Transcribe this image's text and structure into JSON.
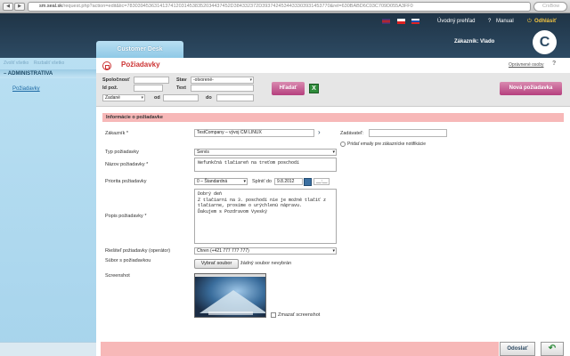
{
  "browser": {
    "back": "◀",
    "forward": "▶",
    "url_host": "sm.seal.sk",
    "url_rest": "/request.php?action=edit&lic=78303945363141374120314538352034437452D384332372D3937424534433303931453770&rel=630BABD6C03C709D055A3FF0",
    "search_placeholder": "CrsBow"
  },
  "header": {
    "flags": [
      "uk-flag",
      "cz-flag",
      "sk-flag"
    ],
    "nav": {
      "home": "Úvodný prehľad",
      "manual": "Manual",
      "logout": "Odhlásiť"
    },
    "tab": "Customer Desk",
    "customer": "Zákazník: Vlado",
    "logo": "C"
  },
  "sidebar": {
    "expand": "Zvoliť všetko",
    "collapse": "Rozbaliť všetko",
    "section": "ADMINISTRATIVA",
    "item": "Požiadavky"
  },
  "page": {
    "title": "Požiadavky",
    "oprav": "Oprávnené osoby",
    "help": "?"
  },
  "filter": {
    "spolocnost_label": "Spoločnosť",
    "spolocnost_value": "",
    "stav_label": "Stav",
    "stav_value": "-otvorené-",
    "id_label": "Id pož.",
    "id_value": "",
    "text_label": "Text",
    "text_value": "",
    "zadane_value": "Zadané",
    "od_label": "od",
    "od_value": "",
    "do_label": "do",
    "do_value": "",
    "search_button": "Hľadať",
    "excel_icon": "X",
    "new_button": "Nová požiadavka"
  },
  "form": {
    "section_title": "Informácie o požiadavke",
    "zakaznik_label": "Zákazník *",
    "zakaznik_value": "TestCompany – vývoj CM LINUX",
    "zadavatel_label": "Zadávateľ:",
    "zadavatel_value": "",
    "emails_label": "Pridať emaily pre zákaznícke notifikácie",
    "typ_label": "Typ požiadavky",
    "typ_value": "Servis",
    "nazov_label": "Názov požiadavky *",
    "nazov_value": "Nefunkčná tlačiareň na treťom poschodí",
    "priorita_label": "Priorita požiadavky",
    "priorita_value": "0 – Štandardná",
    "splnit_label": "Splniť do",
    "splnit_value": "9.8.2012",
    "time_value": "__:__",
    "popis_label": "Popis požiadavky *",
    "popis_value": "Dobrý deň\nZ tlačiarni na 3. poschodí nie je možné tlačiť z tlačiarne, prosíme o urýchlenú nápravu.\nĎakujem s Pozdravom Vyeský",
    "riesitel_label": "Riešiteľ požiadavky (operátor)",
    "riesitel_value": "Chren (+421 777 777 777)",
    "subor_label": "Súbor s požiadavkou",
    "file_button": "Vybrať soubor",
    "file_value": "žádný soubor nevybrán",
    "screenshot_label": "Screenshot",
    "remove_screenshot": "Zmazať screenshot"
  },
  "footer": {
    "send": "Odoslať",
    "back_icon": "↶"
  }
}
